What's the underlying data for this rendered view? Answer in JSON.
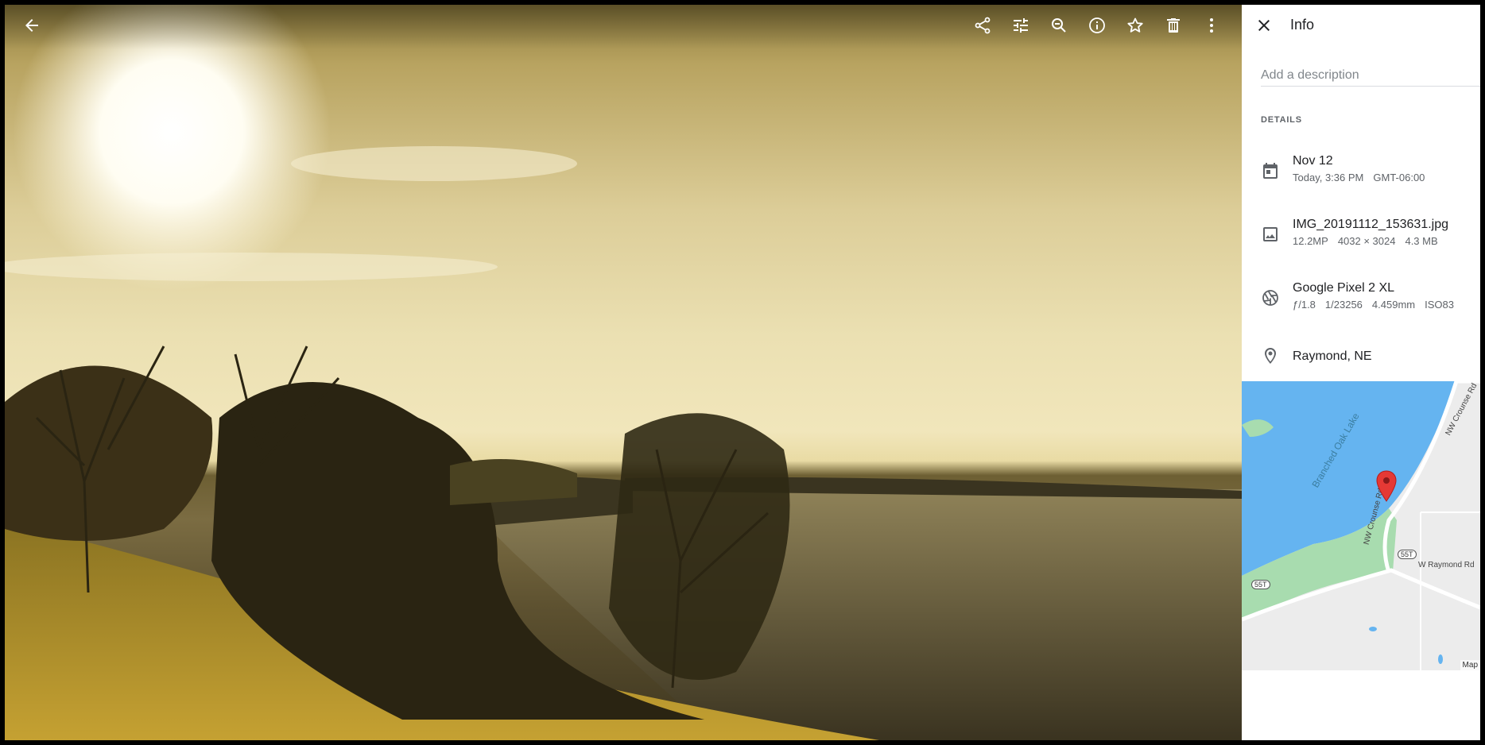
{
  "viewer": {
    "toolbar": {
      "back_icon": "arrow-back-icon",
      "share_icon": "share-icon",
      "edit_icon": "tune-icon",
      "zoom_icon": "zoom-out-icon",
      "info_icon": "info-icon",
      "favorite_icon": "star-icon",
      "delete_icon": "trash-icon",
      "more_icon": "more-vert-icon"
    }
  },
  "info_panel": {
    "title": "Info",
    "description_placeholder": "Add a description",
    "details_heading": "DETAILS",
    "date": {
      "primary": "Nov 12",
      "secondary": [
        "Today, 3:36 PM",
        "GMT-06:00"
      ]
    },
    "file": {
      "primary": "IMG_20191112_153631.jpg",
      "secondary": [
        "12.2MP",
        "4032 × 3024",
        "4.3 MB"
      ]
    },
    "camera": {
      "primary": "Google Pixel 2 XL",
      "secondary": [
        "ƒ/1.8",
        "1/23256",
        "4.459mm",
        "ISO83"
      ]
    },
    "location": {
      "primary": "Raymond, NE"
    },
    "map": {
      "lake_label": "Branched Oak Lake",
      "road_labels": [
        "NW Crounse Rd",
        "NW Crounse Rd",
        "W Raymond Rd"
      ],
      "shields": [
        "55T",
        "55T"
      ],
      "attribution": "Map"
    }
  },
  "colors": {
    "panel_bg": "#ffffff",
    "primary_text": "#202124",
    "secondary_text": "#5f6368",
    "water": "#65b4f0",
    "park": "#a8dcaf",
    "pin": "#e53935"
  }
}
